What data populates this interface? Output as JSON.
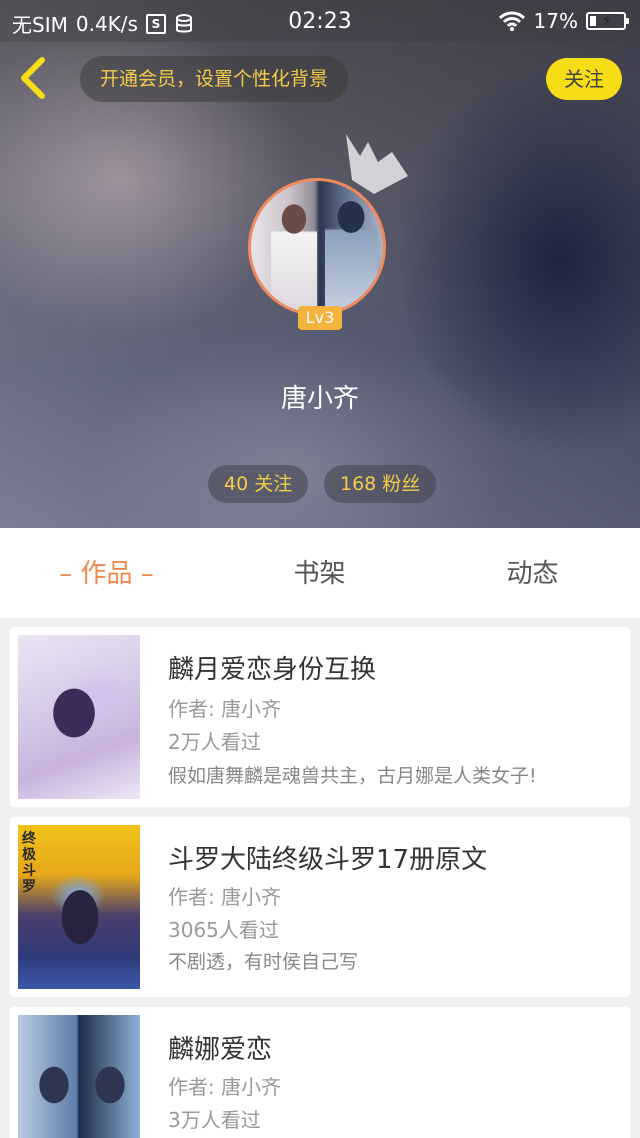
{
  "status_bar": {
    "carrier": "无SIM",
    "speed": "0.4K/s",
    "time": "02:23",
    "battery": "17%"
  },
  "header": {
    "vip_text": "开通会员，设置个性化背景",
    "follow_label": "关注",
    "level": "Lv3",
    "username": "唐小齐",
    "following": "40 关注",
    "followers": "168 粉丝"
  },
  "tabs": [
    {
      "label": "– 作品 –",
      "active": true
    },
    {
      "label": "书架",
      "active": false
    },
    {
      "label": "动态",
      "active": false
    }
  ],
  "works": [
    {
      "title": "麟月爱恋身份互换",
      "author": "作者: 唐小齐",
      "views": "2万人看过",
      "desc": "假如唐舞麟是魂兽共主，古月娜是人类女子!"
    },
    {
      "title": "斗罗大陆终级斗罗17册原文",
      "author": "作者: 唐小齐",
      "views": "3065人看过",
      "desc": "不剧透，有时侯自己写",
      "cover_text": "终极 斗罗"
    },
    {
      "title": "麟娜爱恋",
      "author": "作者: 唐小齐",
      "views": "3万人看过",
      "desc": ""
    }
  ],
  "colors": {
    "accent": "#f08a4c",
    "follow_button": "#f7dd16",
    "vip_text": "#f3cc4a"
  }
}
